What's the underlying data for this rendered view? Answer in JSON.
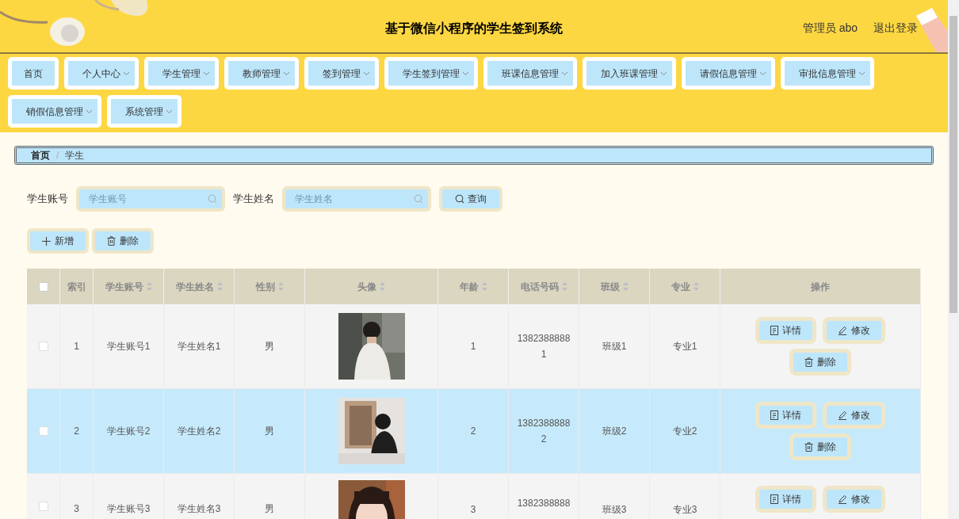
{
  "header": {
    "title": "基于微信小程序的学生签到系统",
    "user": "管理员 abo",
    "logout": "退出登录"
  },
  "nav": [
    {
      "label": "首页",
      "dropdown": false
    },
    {
      "label": "个人中心",
      "dropdown": true
    },
    {
      "label": "学生管理",
      "dropdown": true
    },
    {
      "label": "教师管理",
      "dropdown": true
    },
    {
      "label": "签到管理",
      "dropdown": true
    },
    {
      "label": "学生签到管理",
      "dropdown": true
    },
    {
      "label": "班课信息管理",
      "dropdown": true
    },
    {
      "label": "加入班课管理",
      "dropdown": true
    },
    {
      "label": "请假信息管理",
      "dropdown": true
    },
    {
      "label": "审批信息管理",
      "dropdown": true
    },
    {
      "label": "销假信息管理",
      "dropdown": true
    },
    {
      "label": "系统管理",
      "dropdown": true
    }
  ],
  "breadcrumb": [
    "首页",
    "学生"
  ],
  "breadcrumb_separator": "/",
  "search": {
    "fields": [
      {
        "label": "学生账号",
        "placeholder": "学生账号"
      },
      {
        "label": "学生姓名",
        "placeholder": "学生姓名"
      }
    ],
    "button": "查询"
  },
  "toolbar": [
    {
      "kind": "add",
      "label": "新增"
    },
    {
      "kind": "delete",
      "label": "删除"
    }
  ],
  "table": {
    "select_all": {
      "checked": false
    },
    "columns": [
      {
        "label": "索引",
        "sortable": false
      },
      {
        "label": "学生账号",
        "sortable": true
      },
      {
        "label": "学生姓名",
        "sortable": true
      },
      {
        "label": "性别",
        "sortable": true
      },
      {
        "label": "头像",
        "sortable": true
      },
      {
        "label": "年龄",
        "sortable": true
      },
      {
        "label": "电话号码",
        "sortable": true
      },
      {
        "label": "班级",
        "sortable": true
      },
      {
        "label": "专业",
        "sortable": true
      },
      {
        "label": "操作",
        "sortable": false
      }
    ],
    "rows": [
      {
        "checked": false,
        "highlighted": false,
        "cells": [
          "1",
          "学生账号1",
          "学生姓名1",
          "男"
        ],
        "avatar": {
          "kind": "picture"
        },
        "cells2": [
          "1",
          "1382388888\n1",
          "班级1",
          "专业1"
        ],
        "actions": [
          {
            "kind": "detail",
            "label": "详情"
          },
          {
            "kind": "edit",
            "label": "修改"
          },
          {
            "kind": "delete",
            "label": "删除"
          }
        ]
      },
      {
        "checked": false,
        "highlighted": true,
        "cells": [
          "2",
          "学生账号2",
          "学生姓名2",
          "男"
        ],
        "avatar": {
          "kind": "picture"
        },
        "cells2": [
          "2",
          "1382388888\n2",
          "班级2",
          "专业2"
        ],
        "actions": [
          {
            "kind": "detail",
            "label": "详情"
          },
          {
            "kind": "edit",
            "label": "修改"
          },
          {
            "kind": "delete",
            "label": "删除"
          }
        ]
      },
      {
        "checked": false,
        "highlighted": false,
        "cells": [
          "3",
          "学生账号3",
          "学生姓名3",
          "男"
        ],
        "avatar": {
          "kind": "picture"
        },
        "cells2": [
          "3",
          "1382388888",
          "班级3",
          "专业3"
        ],
        "actions": [
          {
            "kind": "detail",
            "label": "详情"
          },
          {
            "kind": "edit",
            "label": "修改"
          }
        ]
      }
    ]
  }
}
